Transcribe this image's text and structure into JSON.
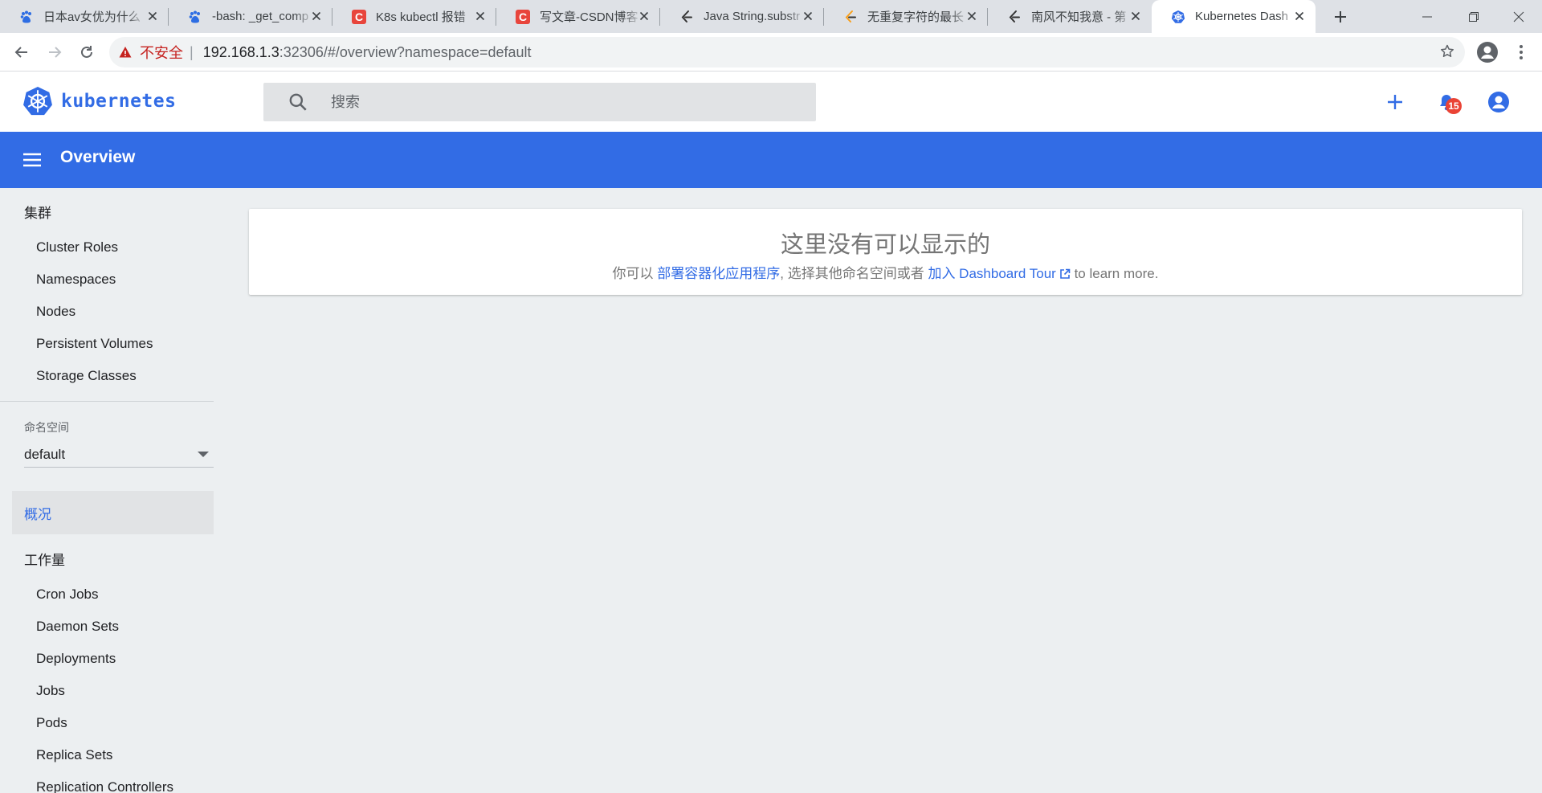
{
  "browser": {
    "tabs": [
      {
        "title": "日本av女优为什么",
        "icon": "baidu-paw-icon"
      },
      {
        "title": "-bash: _get_comp",
        "icon": "baidu-paw-icon"
      },
      {
        "title": "K8s kubectl 报错",
        "icon": "csdn-c-icon"
      },
      {
        "title": "写文章-CSDN博客",
        "icon": "csdn-c-icon"
      },
      {
        "title": "Java String.substr",
        "icon": "leetcode-icon"
      },
      {
        "title": "无重复字符的最长",
        "icon": "leetcode-icon"
      },
      {
        "title": "南风不知我意 - 第",
        "icon": "leetcode-icon"
      },
      {
        "title": "Kubernetes Dash",
        "icon": "kubernetes-icon",
        "active": true
      }
    ],
    "address": {
      "security_label": "不安全",
      "url_host": "192.168.1.3",
      "url_rest": ":32306/#/overview?namespace=default"
    }
  },
  "header": {
    "brand": "kubernetes",
    "search_placeholder": "搜索",
    "notification_count": "15"
  },
  "toolbar": {
    "title": "Overview"
  },
  "sidebar": {
    "cluster_heading": "集群",
    "cluster_items": [
      "Cluster Roles",
      "Namespaces",
      "Nodes",
      "Persistent Volumes",
      "Storage Classes"
    ],
    "namespace_label": "命名空间",
    "namespace_value": "default",
    "overview_label": "概况",
    "workloads_heading": "工作量",
    "workload_items": [
      "Cron Jobs",
      "Daemon Sets",
      "Deployments",
      "Jobs",
      "Pods",
      "Replica Sets",
      "Replication Controllers"
    ]
  },
  "content": {
    "empty_title": "这里没有可以显示的",
    "desc_prefix": "你可以",
    "deploy_link": "部署容器化应用程序",
    "desc_middle": ", 选择其他命名空间或者",
    "tour_link": "加入 Dashboard Tour",
    "desc_suffix": "to learn more."
  },
  "colors": {
    "brand_blue": "#326ce5",
    "badge_red": "#ea4335",
    "background": "#eceff1"
  }
}
